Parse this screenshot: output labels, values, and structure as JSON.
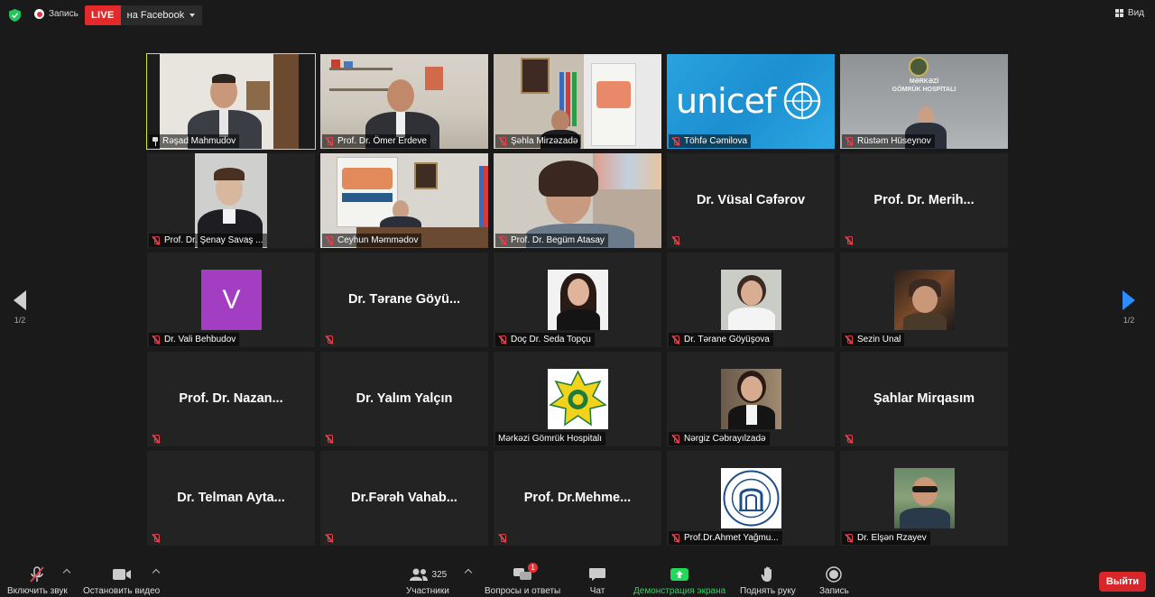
{
  "topbar": {
    "record_label": "Запись",
    "live_badge": "LIVE",
    "live_target": "на Facebook",
    "view_label": "Вид"
  },
  "navigation": {
    "left_page": "1/2",
    "right_page": "1/2"
  },
  "participants": [
    {
      "name": "Rəşad Mahmudov",
      "tile_type": "video",
      "pinned": true,
      "active_speaker": true,
      "muted": false
    },
    {
      "name": "Prof. Dr. Ömer Erdeve",
      "tile_type": "video",
      "muted": true
    },
    {
      "name": "Şəhla Mirzəzadə",
      "tile_type": "video",
      "muted": true
    },
    {
      "name": "Töhfə Cəmilova",
      "tile_type": "video",
      "muted": true,
      "logo_text": "unicef"
    },
    {
      "name": "Rüstəm Hüseynov",
      "tile_type": "video",
      "muted": true,
      "sign_text": "MƏRKƏZİ\nGÖMRÜK HOSPİTALI"
    },
    {
      "name": "Prof. Dr. Şenay Savaş ...",
      "tile_type": "video",
      "muted": true
    },
    {
      "name": "Ceyhun Məmmədov",
      "tile_type": "video",
      "muted": true
    },
    {
      "name": "Prof. Dr. Begüm Atasay",
      "tile_type": "video",
      "muted": true
    },
    {
      "name": "Dr. Vüsal Cəfərov",
      "display_name": "Dr. Vüsal Cəfərov",
      "tile_type": "name",
      "muted": true,
      "show_tag": false
    },
    {
      "name": "Prof. Dr. Merih...",
      "display_name": "Prof. Dr. Merih...",
      "tile_type": "name",
      "muted": true,
      "show_tag": false
    },
    {
      "name": "Dr. Vali Behbudov",
      "tile_type": "letter",
      "letter": "V",
      "muted": true
    },
    {
      "name": "Dr. Tərane Göyü...",
      "display_name": "Dr. Tərane Göyü...",
      "tile_type": "name",
      "muted": true,
      "show_tag": false
    },
    {
      "name": "Doç Dr. Seda Topçu",
      "tile_type": "photo",
      "muted": true
    },
    {
      "name": "Dr. Tərane Göyüşova",
      "tile_type": "photo",
      "muted": true
    },
    {
      "name": "Sezin Unal",
      "tile_type": "photo",
      "muted": true
    },
    {
      "name": "Prof. Dr. Nazan...",
      "display_name": "Prof. Dr. Nazan...",
      "tile_type": "name",
      "muted": true,
      "show_tag": false
    },
    {
      "name": "Dr. Yalım Yalçın",
      "display_name": "Dr. Yalım Yalçın",
      "tile_type": "name",
      "muted": true,
      "show_tag": false
    },
    {
      "name": "Mərkəzi Gömrük Hospitalı",
      "tile_type": "photo",
      "muted": false
    },
    {
      "name": "Nərgiz Cəbrayılzadə",
      "tile_type": "photo",
      "muted": true
    },
    {
      "name": "Şahlar Mirqasım",
      "display_name": "Şahlar Mirqasım",
      "tile_type": "name",
      "muted": true,
      "show_tag": false
    },
    {
      "name": "Dr. Telman Ayta...",
      "display_name": "Dr. Telman Ayta...",
      "tile_type": "name",
      "muted": true,
      "show_tag": false
    },
    {
      "name": "Dr.Fərəh Vahab...",
      "display_name": "Dr.Fərəh Vahab...",
      "tile_type": "name",
      "muted": true,
      "show_tag": false
    },
    {
      "name": "Prof. Dr.Mehme...",
      "display_name": "Prof. Dr.Mehme...",
      "tile_type": "name",
      "muted": true,
      "show_tag": false
    },
    {
      "name": "Prof.Dr.Ahmet Yağmu...",
      "tile_type": "photo",
      "muted": true
    },
    {
      "name": "Dr. Elşən Rzayev",
      "tile_type": "photo",
      "muted": true
    }
  ],
  "toolbar": {
    "audio_label": "Включить звук",
    "video_label": "Остановить видео",
    "participants_label": "Участники",
    "participants_count": "325",
    "qa_label": "Вопросы и ответы",
    "qa_badge": "1",
    "chat_label": "Чат",
    "share_label": "Демонстрация экрана",
    "raise_hand_label": "Поднять руку",
    "record_label": "Запись",
    "exit_label": "Выйти"
  },
  "colors": {
    "active_speaker_outline": "#c8e84d",
    "live_red": "#e32a2a",
    "share_green": "#23d959",
    "exit_red": "#d8262b",
    "muted_red": "#e0414b",
    "nav_blue": "#2d8cff"
  }
}
